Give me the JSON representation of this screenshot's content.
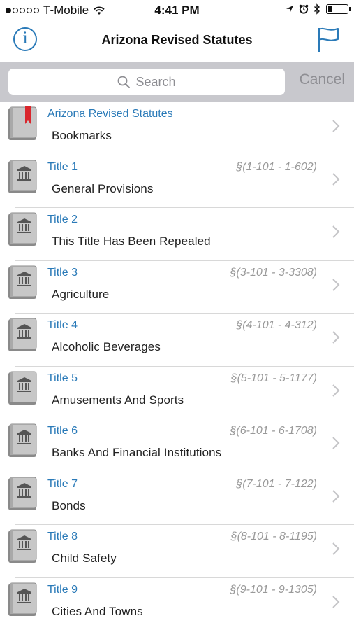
{
  "status_bar": {
    "carrier": "T-Mobile",
    "time": "4:41 PM",
    "signal_bars": 1,
    "signal_total": 5,
    "battery_level": 0.2
  },
  "nav": {
    "title": "Arizona Revised Statutes",
    "info_icon": "info-icon",
    "flag_icon": "flag-icon"
  },
  "search": {
    "placeholder": "Search",
    "cancel_label": "Cancel"
  },
  "colors": {
    "accent": "#2a7ab8",
    "bookmark_ribbon": "#d9262c",
    "search_bg": "#c8c8cd"
  },
  "list": {
    "bookmarks": {
      "title": "Arizona Revised Statutes",
      "subtitle": "Bookmarks",
      "icon": "bookmark-book-icon"
    },
    "titles": [
      {
        "title": "Title 1",
        "range": "§(1-101 - 1-602)",
        "subtitle": "General Provisions"
      },
      {
        "title": "Title 2",
        "range": "",
        "subtitle": "This Title Has Been Repealed"
      },
      {
        "title": "Title 3",
        "range": "§(3-101 - 3-3308)",
        "subtitle": "Agriculture"
      },
      {
        "title": "Title 4",
        "range": "§(4-101 - 4-312)",
        "subtitle": "Alcoholic Beverages"
      },
      {
        "title": "Title 5",
        "range": "§(5-101 - 5-1177)",
        "subtitle": "Amusements And Sports"
      },
      {
        "title": "Title 6",
        "range": "§(6-101 - 6-1708)",
        "subtitle": "Banks And Financial Institutions"
      },
      {
        "title": "Title 7",
        "range": "§(7-101 - 7-122)",
        "subtitle": "Bonds"
      },
      {
        "title": "Title 8",
        "range": "§(8-101 - 8-1195)",
        "subtitle": "Child Safety"
      },
      {
        "title": "Title 9",
        "range": "§(9-101 - 9-1305)",
        "subtitle": "Cities And Towns"
      }
    ]
  }
}
